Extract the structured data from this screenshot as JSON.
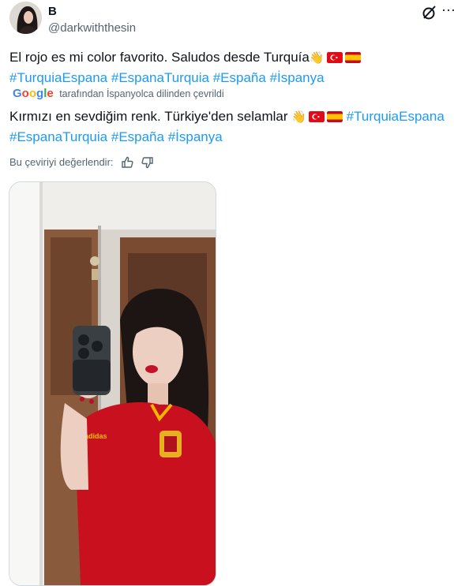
{
  "author": {
    "display_name": "B",
    "handle": "@darkwiththesin"
  },
  "icons": [
    "grok-icon",
    "more-icon",
    "thumbs-up-icon",
    "thumbs-down-icon"
  ],
  "tweet": {
    "original_text": "El rojo es mi color favorito. Saludos desde Turquía",
    "original_hashtags": [
      "#TurquiaEspana",
      "#EspanaTurquia",
      "#España",
      "#İspanya"
    ],
    "translation_source": "tarafından İspanyolca dilinden çevrildi",
    "translated_text": "Kırmızı en sevdiğim renk. Türkiye'den selamlar",
    "translated_hashtags": [
      "#TurquiaEspana",
      "#EspanaTurquia",
      "#España",
      "#İspanya"
    ],
    "rate_prompt": "Bu çeviriyi değerlendir:"
  },
  "colors": {
    "link": "#1d9bf0",
    "muted": "#536471",
    "text": "#0f1419"
  }
}
